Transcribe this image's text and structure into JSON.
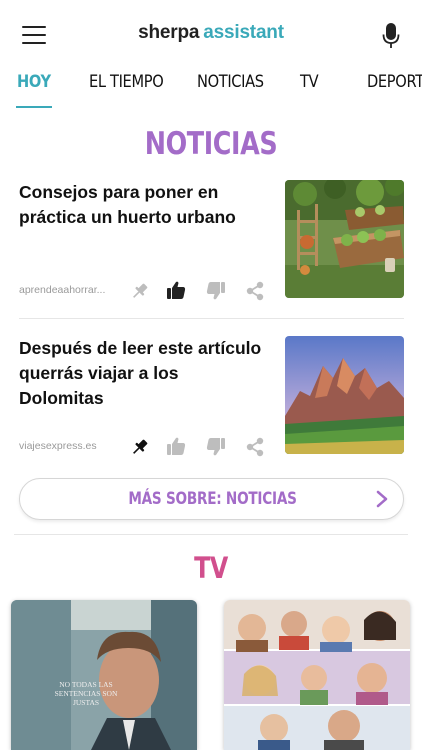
{
  "app": {
    "logo_part1": "sherpa",
    "logo_part2": "assistant"
  },
  "tabs": [
    {
      "label": "HOY",
      "active": true
    },
    {
      "label": "EL TIEMPO",
      "active": false
    },
    {
      "label": "NOTICIAS",
      "active": false
    },
    {
      "label": "TV",
      "active": false
    },
    {
      "label": "DEPORTES",
      "active": false
    }
  ],
  "news": {
    "title": "NOTICIAS",
    "articles": [
      {
        "headline": "Consejos para poner en práctica un huerto urbano",
        "source": "aprendeaahorrar...",
        "pinned": false,
        "liked": true,
        "disliked": false
      },
      {
        "headline": "Después de leer este artículo querrás viajar a los Dolomitas",
        "source": "viajesexpress.es",
        "pinned": true,
        "liked": false,
        "disliked": false
      }
    ],
    "more_label": "MÁS SOBRE: NOTICIAS"
  },
  "tv": {
    "title": "TV",
    "poster1_caption_line1": "NO TODAS LAS",
    "poster1_caption_line2": "SENTENCIAS SON JUSTAS"
  },
  "colors": {
    "accent_teal": "#3aa9b9",
    "news_purple": "#a36cc8",
    "tv_pink": "#d14f8d"
  },
  "icons": [
    "menu-icon",
    "microphone-icon",
    "pin-icon",
    "thumbs-up-icon",
    "thumbs-down-icon",
    "share-icon",
    "chevron-right-icon"
  ]
}
